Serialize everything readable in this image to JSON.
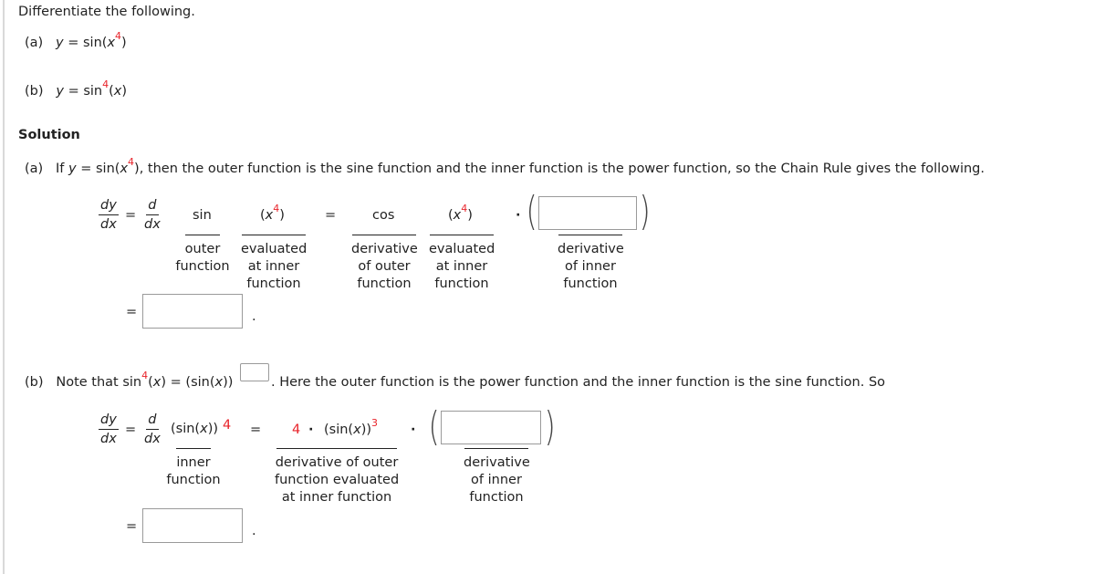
{
  "problem": {
    "instruction": "Differentiate the following.",
    "part_a": {
      "label": "(a)",
      "y": "y",
      "eq": "=",
      "func_pre": "sin(",
      "var": "x",
      "exp": "4",
      "func_post": ")"
    },
    "part_b": {
      "label": "(b)",
      "y": "y",
      "eq": "=",
      "func_pre": "sin",
      "exp": "4",
      "func_post_open": "(",
      "var": "x",
      "func_post_close": ")"
    }
  },
  "solution": {
    "heading": "Solution",
    "a": {
      "label": "(a)",
      "intro_if": "If",
      "intro_y": "y",
      "intro_eq": "= sin(",
      "intro_var": "x",
      "intro_exp": "4",
      "intro_rest": "), then the outer function is the sine function and the inner function is the power function, so the Chain Rule gives the following.",
      "dy": "dy",
      "dx": "dx",
      "d": "d",
      "eq": "=",
      "sin": "sin",
      "inner_open": "(",
      "inner_var": "x",
      "inner_exp": "4",
      "inner_close": ")",
      "cos": "cos",
      "dot": "·",
      "labels": {
        "outer": [
          "outer",
          "function"
        ],
        "evaluated": [
          "evaluated",
          "at inner",
          "function"
        ],
        "derivative_outer": [
          "derivative",
          "of outer",
          "function"
        ],
        "evaluated2": [
          "evaluated",
          "at inner",
          "function"
        ],
        "derivative_inner": [
          "derivative",
          "of inner",
          "function"
        ]
      },
      "inner_derivative_answer": "",
      "final_answer": "",
      "period": "."
    },
    "b": {
      "label": "(b)",
      "intro_note": "Note that sin",
      "intro_exp": "4",
      "intro_mid_open": "(",
      "intro_var": "x",
      "intro_mid_close": ") = (sin(",
      "intro_var2": "x",
      "intro_close": "))",
      "exponent_answer": "",
      "intro_rest": ". Here the outer function is the power function and the inner function is the sine function. So",
      "dy": "dy",
      "dx": "dx",
      "d": "d",
      "eq": "=",
      "inner_expr_pre": "(sin(",
      "inner_expr_var": "x",
      "inner_expr_post": "))",
      "inner_exp": "4",
      "coef": "4",
      "dot": "·",
      "outer_expr_pre": "(sin(",
      "outer_expr_var": "x",
      "outer_expr_post": "))",
      "outer_exp": "3",
      "labels": {
        "inner": [
          "inner",
          "function"
        ],
        "derivative_outer": [
          "derivative of outer",
          "function evaluated",
          "at inner function"
        ],
        "derivative_inner": [
          "derivative",
          "of inner",
          "function"
        ]
      },
      "inner_derivative_answer": "",
      "final_answer": "",
      "period": "."
    }
  },
  "colors": {
    "highlight": "#e8232a",
    "text": "#222222",
    "input_border": "#9a9a9a"
  }
}
